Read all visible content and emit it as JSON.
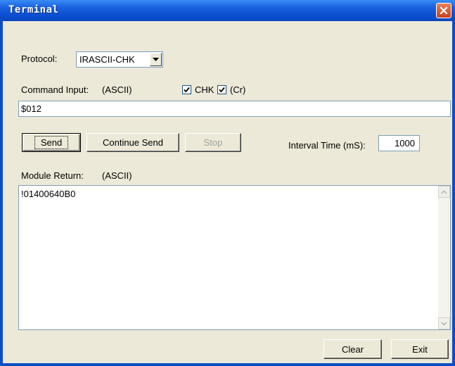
{
  "window": {
    "title": "Terminal"
  },
  "protocol": {
    "label": "Protocol:",
    "selected": "IRASCII-CHK"
  },
  "command": {
    "label": "Command Input:",
    "mode": "(ASCII)",
    "chk_label": "CHK",
    "cr_label": "(Cr)",
    "chk_checked": true,
    "cr_checked": true,
    "value": "$012"
  },
  "buttons": {
    "send": "Send",
    "continue_send": "Continue Send",
    "stop": "Stop",
    "clear": "Clear",
    "exit": "Exit"
  },
  "interval": {
    "label": "Interval Time (mS):",
    "value": "1000"
  },
  "module_return": {
    "label": "Module Return:",
    "mode": "(ASCII)",
    "text": "!01400640B0"
  },
  "colors": {
    "title_bar": "#0c50d2",
    "dialog_bg": "#ece9d8",
    "close_button": "#d9532c",
    "field_border": "#7f9db9"
  }
}
